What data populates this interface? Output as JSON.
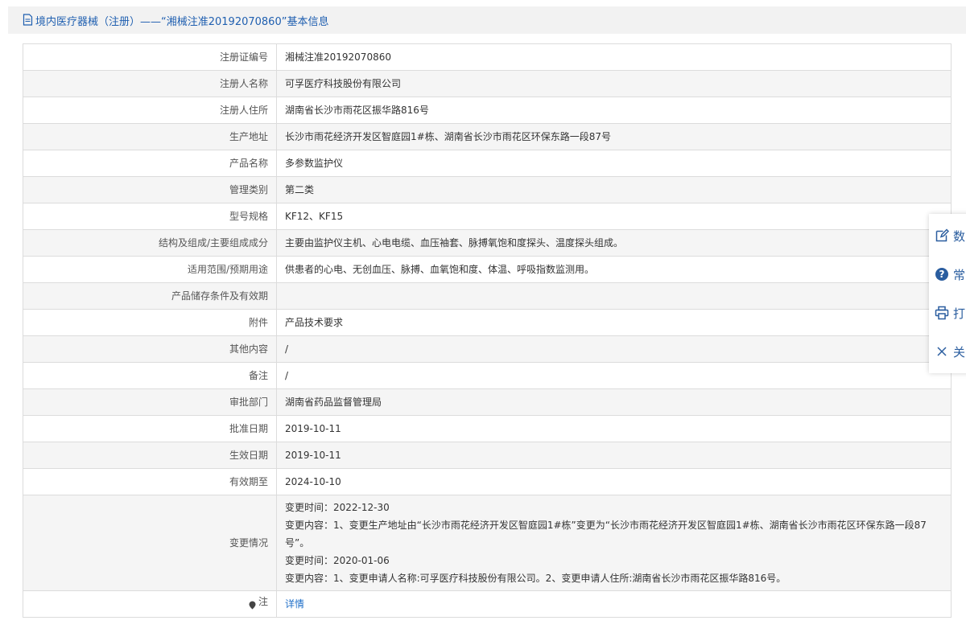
{
  "header": {
    "title": "境内医疗器械（注册）——“湘械注准20192070860”基本信息"
  },
  "rows": [
    {
      "label": "注册证编号",
      "value": "湘械注准20192070860"
    },
    {
      "label": "注册人名称",
      "value": "可孚医疗科技股份有限公司"
    },
    {
      "label": "注册人住所",
      "value": "湖南省长沙市雨花区振华路816号"
    },
    {
      "label": "生产地址",
      "value": "长沙市雨花经济开发区智庭园1#栋、湖南省长沙市雨花区环保东路一段87号"
    },
    {
      "label": "产品名称",
      "value": "多参数监护仪"
    },
    {
      "label": "管理类别",
      "value": "第二类"
    },
    {
      "label": "型号规格",
      "value": "KF12、KF15"
    },
    {
      "label": "结构及组成/主要组成成分",
      "value": "主要由监护仪主机、心电电缆、血压袖套、脉搏氧饱和度探头、温度探头组成。"
    },
    {
      "label": "适用范围/预期用途",
      "value": "供患者的心电、无创血压、脉搏、血氧饱和度、体温、呼吸指数监测用。"
    },
    {
      "label": "产品储存条件及有效期",
      "value": ""
    },
    {
      "label": "附件",
      "value": "产品技术要求"
    },
    {
      "label": "其他内容",
      "value": "/"
    },
    {
      "label": "备注",
      "value": "/"
    },
    {
      "label": "审批部门",
      "value": "湖南省药品监督管理局"
    },
    {
      "label": "批准日期",
      "value": "2019-10-11"
    },
    {
      "label": "生效日期",
      "value": "2019-10-11"
    },
    {
      "label": "有效期至",
      "value": "2024-10-10"
    }
  ],
  "changes": {
    "label": "变更情况",
    "lines": [
      "变更时间：2022-12-30",
      "变更内容：1、变更生产地址由“长沙市雨花经济开发区智庭园1#栋”变更为“长沙市雨花经济开发区智庭园1#栋、湖南省长沙市雨花区环保东路一段87号”。",
      "变更时间：2020-01-06",
      "变更内容：1、变更申请人名称:可孚医疗科技股份有限公司。2、变更申请人住所:湖南省长沙市雨花区振华路816号。"
    ]
  },
  "note": {
    "label": "注",
    "link": "详情"
  },
  "side_panel": {
    "items": [
      {
        "label": "数",
        "icon": "edit-icon"
      },
      {
        "label": "常",
        "icon": "help-icon"
      },
      {
        "label": "打",
        "icon": "print-icon"
      },
      {
        "label": "关",
        "icon": "close-icon"
      }
    ]
  },
  "colors": {
    "header_text": "#1f5fb0",
    "link": "#1f6fc8",
    "side_text": "#2a5d9f"
  }
}
